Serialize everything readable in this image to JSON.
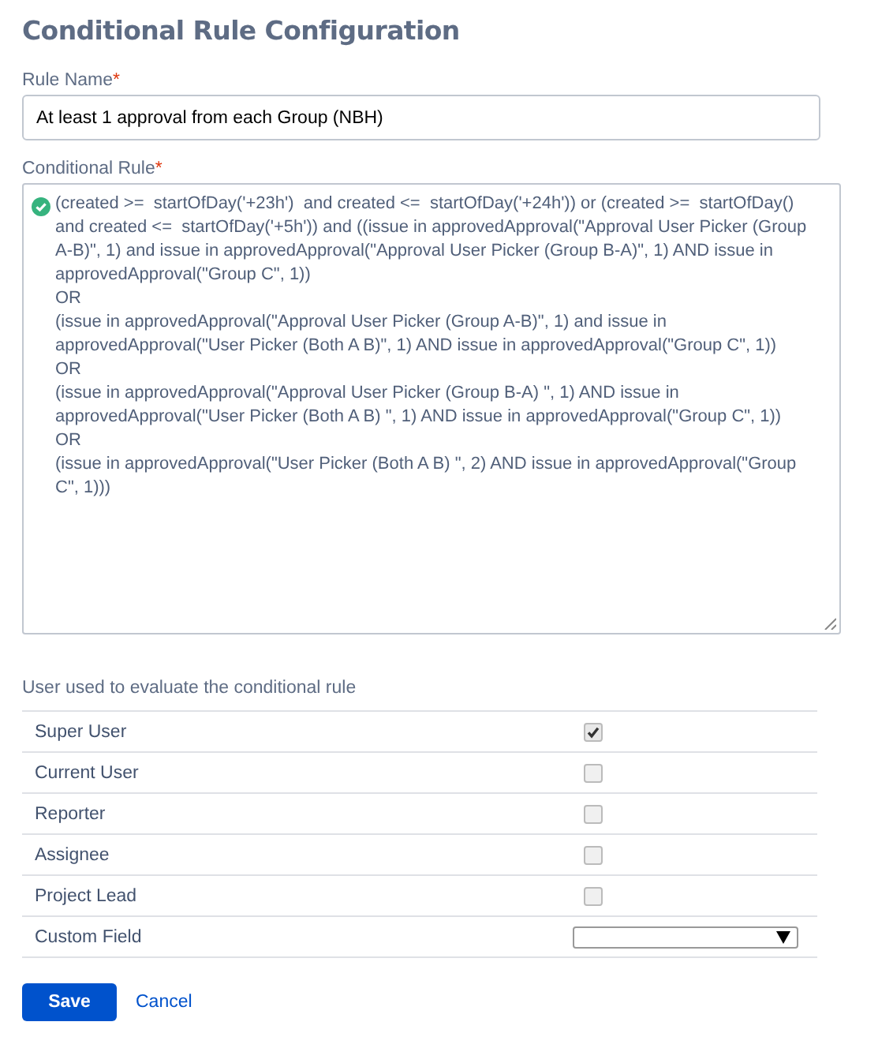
{
  "title": "Conditional Rule Configuration",
  "rule_name": {
    "label": "Rule Name",
    "required_mark": "*",
    "value": "At least 1 approval from each Group (NBH)"
  },
  "conditional_rule": {
    "label": "Conditional Rule",
    "required_mark": "*",
    "valid": true,
    "value": "(created >=  startOfDay('+23h')  and created <=  startOfDay('+24h')) or (created >=  startOfDay() and created <=  startOfDay('+5h')) and ((issue in approvedApproval(\"Approval User Picker (Group A-B)\", 1) and issue in approvedApproval(\"Approval User Picker (Group B-A)\", 1) AND issue in approvedApproval(\"Group C\", 1))\nOR\n(issue in approvedApproval(\"Approval User Picker (Group A-B)\", 1) and issue in approvedApproval(\"User Picker (Both A B)\", 1) AND issue in approvedApproval(\"Group C\", 1))\nOR\n(issue in approvedApproval(\"Approval User Picker (Group B-A) \", 1) AND issue in approvedApproval(\"User Picker (Both A B) \", 1) AND issue in approvedApproval(\"Group C\", 1))\nOR\n(issue in approvedApproval(\"User Picker (Both A B) \", 2) AND issue in approvedApproval(\"Group C\", 1)))"
  },
  "user_section": {
    "label": "User used to evaluate the conditional rule",
    "rows": [
      {
        "label": "Super User",
        "kind": "checkbox",
        "checked": true
      },
      {
        "label": "Current User",
        "kind": "checkbox",
        "checked": false
      },
      {
        "label": "Reporter",
        "kind": "checkbox",
        "checked": false
      },
      {
        "label": "Assignee",
        "kind": "checkbox",
        "checked": false
      },
      {
        "label": "Project Lead",
        "kind": "checkbox",
        "checked": false
      },
      {
        "label": "Custom Field",
        "kind": "select"
      }
    ]
  },
  "buttons": {
    "save": "Save",
    "cancel": "Cancel"
  }
}
